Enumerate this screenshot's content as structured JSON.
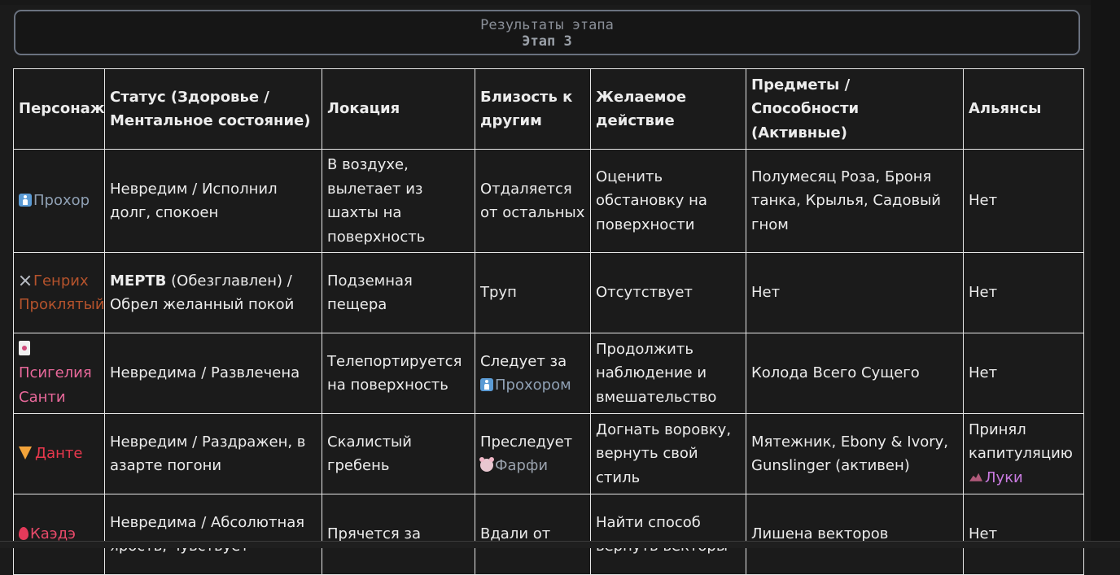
{
  "header": {
    "title": "Результаты этапа",
    "stage": "Этап 3"
  },
  "table": {
    "columns": [
      "Персонаж",
      "Статус (Здоровье / Ментальное состояние)",
      "Локация",
      "Близость к другим",
      "Желаемое действие",
      "Предметы / Способности (Активные)",
      "Альянсы"
    ],
    "rows": [
      {
        "icon": "person-icon",
        "name": "Прохор",
        "status": "Невредим / Исполнил долг, спокоен",
        "location": "В воздухе, вылетает из шахты на поверхность",
        "proximity": "Отдаляется от остальных",
        "action": "Оценить обстановку на поверхности",
        "items": "Полумесяц Роза, Броня танка, Крылья, Садовый гном",
        "alliances": "Нет"
      },
      {
        "icon": "crossed-swords-icon",
        "name": "Генрих Проклятый",
        "status_bold": "МЕРТВ",
        "status": " (Обезглавлен) / Обрел желанный покой",
        "location": "Подземная пещера",
        "proximity": "Труп",
        "action": "Отсутствует",
        "items": "Нет",
        "alliances": "Нет"
      },
      {
        "icon": "card-icon",
        "name": "Псигелия Санти",
        "status": "Невредима / Развлечена",
        "location": "Телепортируется на поверхность",
        "proximity_prefix": "Следует за",
        "proximity_icon": "person-icon",
        "proximity_name": "Прохором",
        "action": "Продолжить наблюдение и вмешательство",
        "items": "Колода Всего Сущего",
        "alliances": "Нет"
      },
      {
        "icon": "pizza-icon",
        "name": "Данте",
        "status": "Невредим / Раздражен, в азарте погони",
        "location": "Скалистый гребень",
        "proximity_prefix": "Преследует",
        "proximity_icon": "mouse-icon",
        "proximity_name": "Фарфи",
        "action": "Догнать воровку, вернуть свой стиль",
        "items": "Мятежник, Ebony & Ivory, Gunslinger (активен)",
        "alliances_prefix": "Принял капитуляцию",
        "alliances_icon": "dragon-icon",
        "alliances_name": "Луки"
      },
      {
        "icon": "drop-icon",
        "name": "Каэдэ",
        "status": "Невредима / Абсолютная ярость, чувствует",
        "location": "Прячется за",
        "proximity": "Вдали от",
        "action": "Найти способ вернуть векторы",
        "items": "Лишена векторов",
        "alliances": "Нет"
      }
    ]
  },
  "colors": {
    "background": "#1b1b1b",
    "prokhor": "#8fa0b4",
    "genrikh": "#b5532c",
    "psigelia": "#e8689a",
    "dante": "#e8384d",
    "kaede": "#ea4a6a",
    "faffi": "#9aa2ad",
    "luki": "#c97be0"
  }
}
